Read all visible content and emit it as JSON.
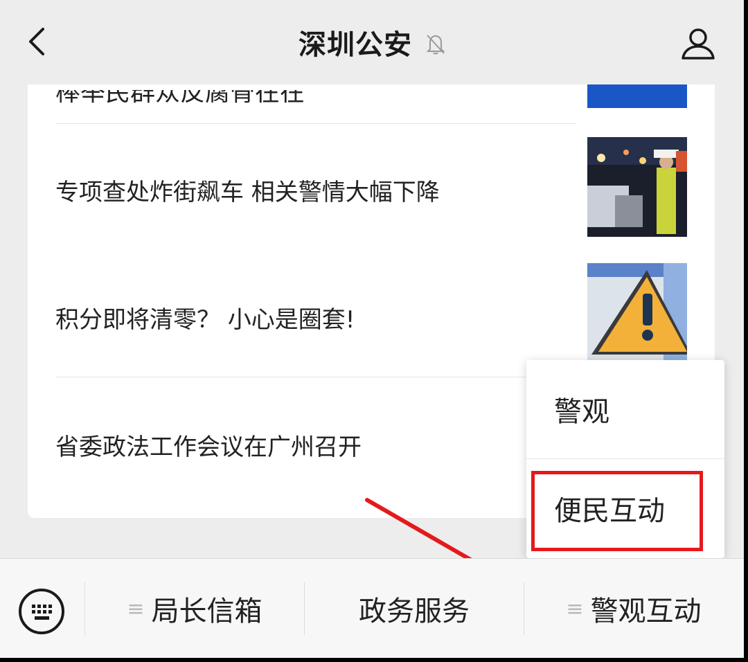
{
  "header": {
    "title": "深圳公安",
    "back_icon": "chevron-left-icon",
    "mute_icon": "bell-off-icon",
    "profile_icon": "person-icon"
  },
  "articles": [
    {
      "title": "棒举民群众反腐骨在在",
      "partial": true
    },
    {
      "title": "专项查处炸街飙车 相关警情大幅下降"
    },
    {
      "title": "积分即将清零？ 小心是圈套!"
    },
    {
      "title": "省委政法工作会议在广州召开"
    }
  ],
  "popup_menu": {
    "items": [
      "警观",
      "便民互动"
    ],
    "highlighted_index": 1,
    "highlight_color": "#e5191c"
  },
  "bottom_bar": {
    "keyboard_icon": "keyboard-icon",
    "menu_icon": "≡",
    "items": [
      "局长信箱",
      "政务服务",
      "警观互动"
    ]
  },
  "colors": {
    "background": "#ededed",
    "accent_red": "#e5191c",
    "thumb_blue": "#1b56c6"
  }
}
